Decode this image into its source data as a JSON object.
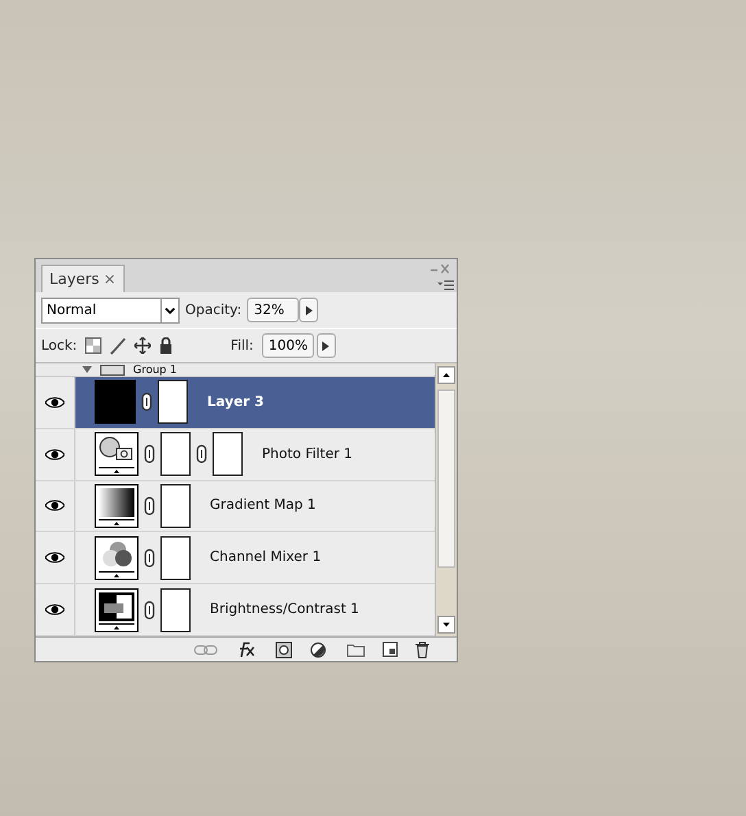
{
  "panel": {
    "tab": "Layers",
    "tab_close": "×",
    "blend_mode": "Normal",
    "opacity_label": "Opacity:",
    "opacity": "32%",
    "lock_label": "Lock:",
    "fill_label": "Fill:",
    "fill": "100%"
  },
  "group": {
    "name": "Group 1",
    "expanded": true
  },
  "layers": [
    {
      "name": "Layer 3",
      "kind": "pixel",
      "visible": true,
      "selected": true,
      "vector_mask": false
    },
    {
      "name": "Photo Filter 1",
      "kind": "photo-filter",
      "visible": true,
      "selected": false,
      "vector_mask": true
    },
    {
      "name": "Gradient Map 1",
      "kind": "gradient",
      "visible": true,
      "selected": false,
      "vector_mask": false
    },
    {
      "name": "Channel Mixer 1",
      "kind": "channel-mixer",
      "visible": true,
      "selected": false,
      "vector_mask": false
    },
    {
      "name": "Brightness/Contrast 1",
      "kind": "brightness",
      "visible": true,
      "selected": false,
      "vector_mask": false
    }
  ]
}
